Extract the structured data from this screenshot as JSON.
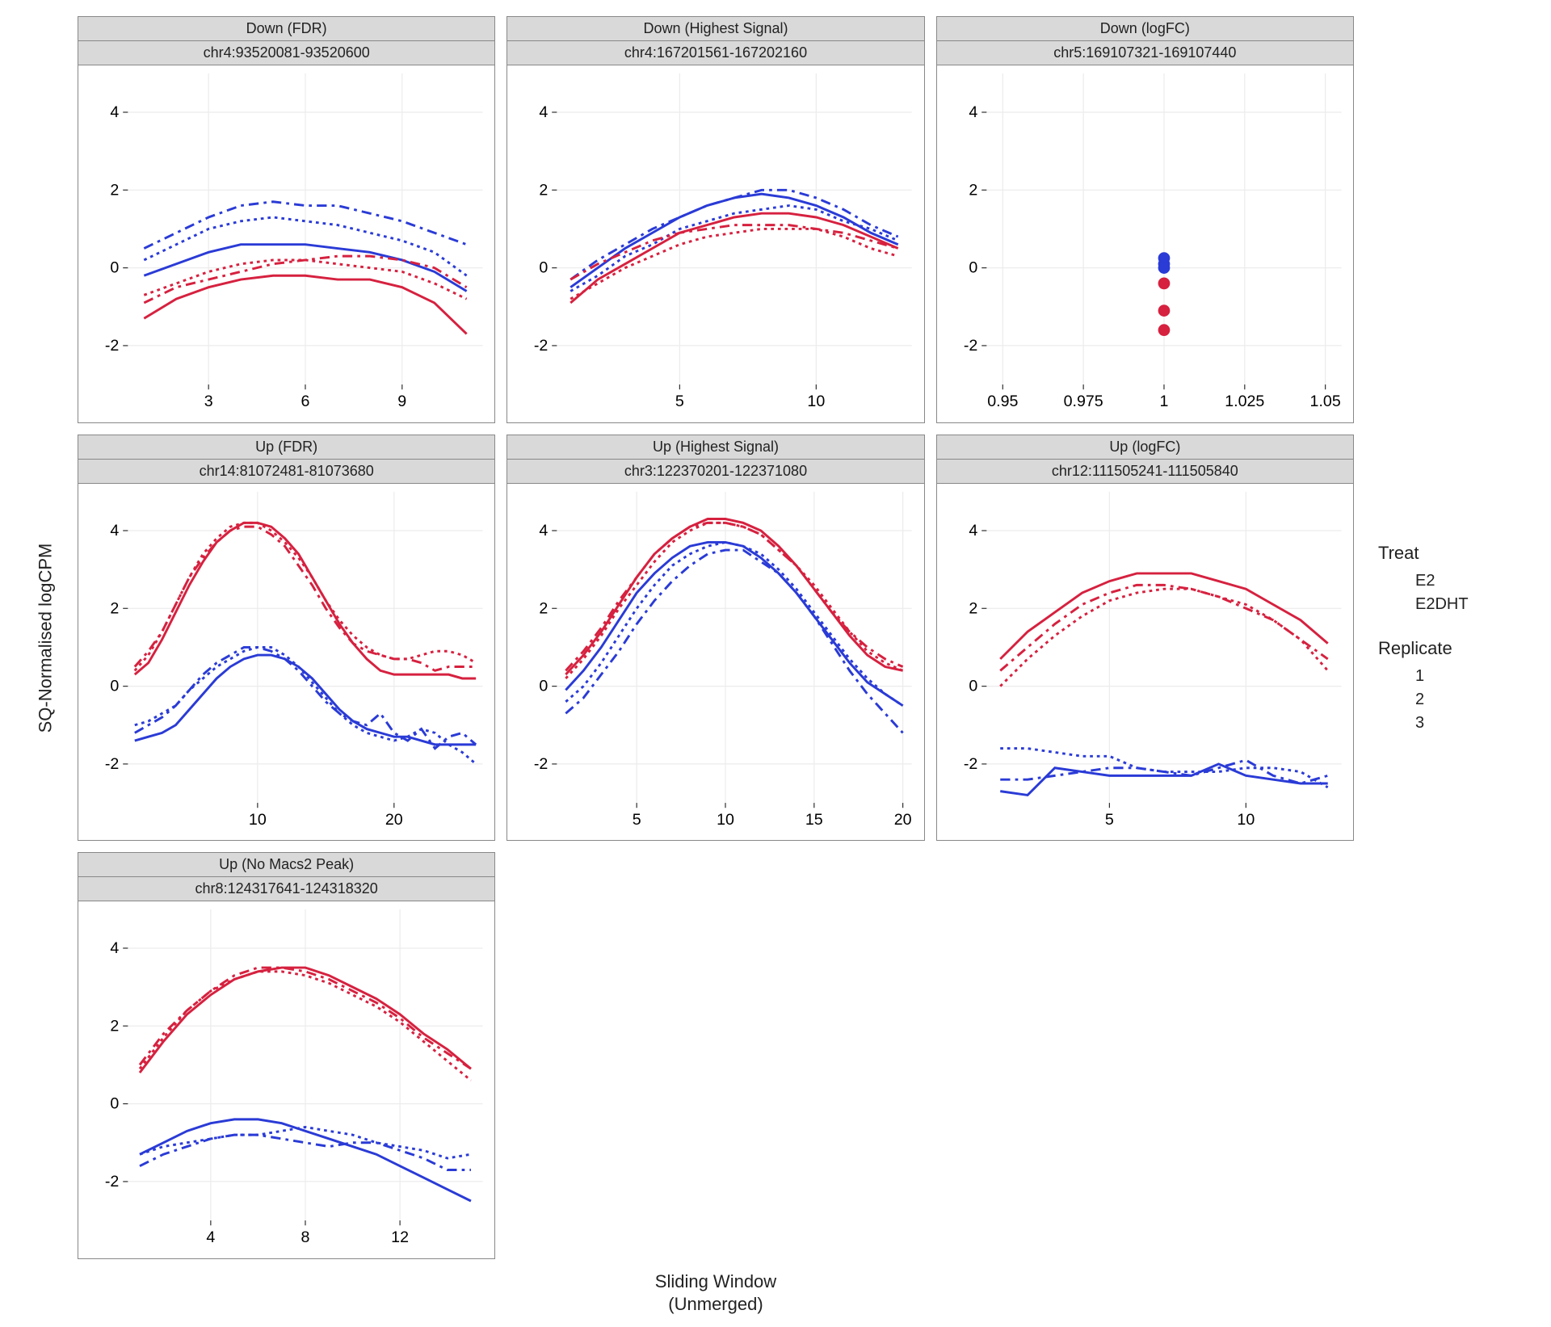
{
  "ylab": "SQ-Normalised logCPM",
  "xlab": "Sliding Window\n(Unmerged)",
  "legend": {
    "treat_title": "Treat",
    "treat": [
      {
        "name": "E2",
        "color": "#2a3bd6"
      },
      {
        "name": "E2DHT",
        "color": "#d6213f"
      }
    ],
    "rep_title": "Replicate",
    "rep": [
      {
        "name": "1",
        "dash": "solid"
      },
      {
        "name": "2",
        "dash": "dash2"
      },
      {
        "name": "3",
        "dash": "dash3"
      }
    ]
  },
  "chart_data": [
    {
      "title": "Down (FDR)",
      "subtitle": "chr4:93520081-93520600",
      "type": "line",
      "ylim": [
        -3,
        5
      ],
      "yticks": [
        -2,
        0,
        2,
        4
      ],
      "x": [
        1,
        2,
        3,
        4,
        5,
        6,
        7,
        8,
        9,
        10,
        11
      ],
      "xticks": [
        3,
        6,
        9
      ],
      "series": [
        {
          "treat": "E2",
          "rep": 1,
          "y": [
            -0.2,
            0.1,
            0.4,
            0.6,
            0.6,
            0.6,
            0.5,
            0.4,
            0.2,
            -0.1,
            -0.6
          ]
        },
        {
          "treat": "E2",
          "rep": 2,
          "y": [
            0.2,
            0.6,
            1.0,
            1.2,
            1.3,
            1.2,
            1.1,
            0.9,
            0.7,
            0.4,
            -0.2
          ]
        },
        {
          "treat": "E2",
          "rep": 3,
          "y": [
            0.5,
            0.9,
            1.3,
            1.6,
            1.7,
            1.6,
            1.6,
            1.4,
            1.2,
            0.9,
            0.6
          ]
        },
        {
          "treat": "E2DHT",
          "rep": 1,
          "y": [
            -1.3,
            -0.8,
            -0.5,
            -0.3,
            -0.2,
            -0.2,
            -0.3,
            -0.3,
            -0.5,
            -0.9,
            -1.7
          ]
        },
        {
          "treat": "E2DHT",
          "rep": 2,
          "y": [
            -0.7,
            -0.4,
            -0.1,
            0.1,
            0.2,
            0.2,
            0.1,
            0.0,
            -0.1,
            -0.4,
            -0.8
          ]
        },
        {
          "treat": "E2DHT",
          "rep": 3,
          "y": [
            -0.9,
            -0.5,
            -0.3,
            -0.1,
            0.1,
            0.2,
            0.3,
            0.3,
            0.2,
            0.0,
            -0.5
          ]
        }
      ]
    },
    {
      "title": "Down (Highest Signal)",
      "subtitle": "chr4:167201561-167202160",
      "type": "line",
      "ylim": [
        -3,
        5
      ],
      "yticks": [
        -2,
        0,
        2,
        4
      ],
      "x": [
        1,
        2,
        3,
        4,
        5,
        6,
        7,
        8,
        9,
        10,
        11,
        12,
        13
      ],
      "xticks": [
        5,
        10
      ],
      "series": [
        {
          "treat": "E2",
          "rep": 1,
          "y": [
            -0.5,
            0.0,
            0.5,
            0.9,
            1.3,
            1.6,
            1.8,
            1.9,
            1.8,
            1.6,
            1.3,
            0.9,
            0.6
          ]
        },
        {
          "treat": "E2",
          "rep": 2,
          "y": [
            -0.6,
            -0.2,
            0.3,
            0.6,
            1.0,
            1.2,
            1.4,
            1.5,
            1.6,
            1.5,
            1.2,
            1.0,
            0.7
          ]
        },
        {
          "treat": "E2",
          "rep": 3,
          "y": [
            -0.3,
            0.2,
            0.6,
            1.0,
            1.3,
            1.6,
            1.8,
            2.0,
            2.0,
            1.8,
            1.5,
            1.1,
            0.8
          ]
        },
        {
          "treat": "E2DHT",
          "rep": 1,
          "y": [
            -0.9,
            -0.3,
            0.1,
            0.5,
            0.9,
            1.1,
            1.3,
            1.4,
            1.4,
            1.3,
            1.1,
            0.8,
            0.5
          ]
        },
        {
          "treat": "E2DHT",
          "rep": 2,
          "y": [
            -0.8,
            -0.4,
            0.0,
            0.3,
            0.6,
            0.8,
            0.9,
            1.0,
            1.0,
            1.0,
            0.8,
            0.5,
            0.3
          ]
        },
        {
          "treat": "E2DHT",
          "rep": 3,
          "y": [
            -0.3,
            0.1,
            0.4,
            0.7,
            0.9,
            1.0,
            1.1,
            1.1,
            1.1,
            1.0,
            0.9,
            0.7,
            0.5
          ]
        }
      ]
    },
    {
      "title": "Down (logFC)",
      "subtitle": "chr5:169107321-169107440",
      "type": "scatter",
      "ylim": [
        -3,
        5
      ],
      "yticks": [
        -2,
        0,
        2,
        4
      ],
      "x": [
        1.0
      ],
      "xticks": [
        0.95,
        0.975,
        1.0,
        1.025,
        1.05
      ],
      "xlim": [
        0.945,
        1.055
      ],
      "points": [
        {
          "treat": "E2",
          "rep": 1,
          "x": 1.0,
          "y": 0.25
        },
        {
          "treat": "E2",
          "rep": 2,
          "x": 1.0,
          "y": 0.1
        },
        {
          "treat": "E2",
          "rep": 3,
          "x": 1.0,
          "y": 0.0
        },
        {
          "treat": "E2DHT",
          "rep": 1,
          "x": 1.0,
          "y": -0.4
        },
        {
          "treat": "E2DHT",
          "rep": 2,
          "x": 1.0,
          "y": -1.1
        },
        {
          "treat": "E2DHT",
          "rep": 3,
          "x": 1.0,
          "y": -1.6
        }
      ]
    },
    {
      "title": "Up (FDR)",
      "subtitle": "chr14:81072481-81073680",
      "type": "line",
      "ylim": [
        -3,
        5
      ],
      "yticks": [
        -2,
        0,
        2,
        4
      ],
      "x": [
        1,
        2,
        3,
        4,
        5,
        6,
        7,
        8,
        9,
        10,
        11,
        12,
        13,
        14,
        15,
        16,
        17,
        18,
        19,
        20,
        21,
        22,
        23,
        24,
        25,
        26
      ],
      "xticks": [
        10,
        20
      ],
      "series": [
        {
          "treat": "E2",
          "rep": 1,
          "y": [
            -1.4,
            -1.3,
            -1.2,
            -1.0,
            -0.6,
            -0.2,
            0.2,
            0.5,
            0.7,
            0.8,
            0.8,
            0.7,
            0.5,
            0.2,
            -0.2,
            -0.6,
            -0.9,
            -1.1,
            -1.2,
            -1.3,
            -1.3,
            -1.4,
            -1.5,
            -1.5,
            -1.5,
            -1.5
          ]
        },
        {
          "treat": "E2",
          "rep": 2,
          "y": [
            -1.0,
            -0.9,
            -0.7,
            -0.5,
            -0.1,
            0.2,
            0.5,
            0.7,
            0.9,
            1.0,
            1.0,
            0.8,
            0.5,
            0.1,
            -0.3,
            -0.7,
            -1.0,
            -1.2,
            -1.3,
            -1.4,
            -1.3,
            -1.1,
            -1.2,
            -1.5,
            -1.7,
            -2.0
          ]
        },
        {
          "treat": "E2",
          "rep": 3,
          "y": [
            -1.2,
            -1.0,
            -0.8,
            -0.5,
            -0.1,
            0.3,
            0.6,
            0.8,
            1.0,
            1.0,
            0.9,
            0.7,
            0.4,
            0.0,
            -0.4,
            -0.7,
            -0.9,
            -1.0,
            -0.7,
            -1.2,
            -1.4,
            -1.1,
            -1.6,
            -1.3,
            -1.2,
            -1.5
          ]
        },
        {
          "treat": "E2DHT",
          "rep": 1,
          "y": [
            0.3,
            0.6,
            1.2,
            1.9,
            2.6,
            3.2,
            3.7,
            4.0,
            4.2,
            4.2,
            4.1,
            3.8,
            3.4,
            2.8,
            2.2,
            1.6,
            1.1,
            0.7,
            0.4,
            0.3,
            0.3,
            0.3,
            0.3,
            0.3,
            0.2,
            0.2
          ]
        },
        {
          "treat": "E2DHT",
          "rep": 2,
          "y": [
            0.4,
            0.8,
            1.4,
            2.1,
            2.8,
            3.4,
            3.8,
            4.1,
            4.2,
            4.2,
            4.0,
            3.7,
            3.3,
            2.8,
            2.2,
            1.7,
            1.3,
            1.0,
            0.8,
            0.7,
            0.7,
            0.8,
            0.9,
            0.9,
            0.8,
            0.6
          ]
        },
        {
          "treat": "E2DHT",
          "rep": 3,
          "y": [
            0.5,
            0.9,
            1.4,
            2.1,
            2.8,
            3.3,
            3.7,
            4.0,
            4.1,
            4.1,
            3.9,
            3.6,
            3.1,
            2.6,
            2.0,
            1.5,
            1.1,
            0.9,
            0.8,
            0.7,
            0.7,
            0.6,
            0.4,
            0.5,
            0.5,
            0.5
          ]
        }
      ]
    },
    {
      "title": "Up (Highest Signal)",
      "subtitle": "chr3:122370201-122371080",
      "type": "line",
      "ylim": [
        -3,
        5
      ],
      "yticks": [
        -2,
        0,
        2,
        4
      ],
      "x": [
        1,
        2,
        3,
        4,
        5,
        6,
        7,
        8,
        9,
        10,
        11,
        12,
        13,
        14,
        15,
        16,
        17,
        18,
        19,
        20
      ],
      "xticks": [
        5,
        10,
        15,
        20
      ],
      "series": [
        {
          "treat": "E2",
          "rep": 1,
          "y": [
            -0.1,
            0.4,
            1.0,
            1.7,
            2.4,
            2.9,
            3.3,
            3.6,
            3.7,
            3.7,
            3.6,
            3.3,
            2.9,
            2.4,
            1.8,
            1.2,
            0.6,
            0.1,
            -0.2,
            -0.5
          ]
        },
        {
          "treat": "E2",
          "rep": 2,
          "y": [
            -0.4,
            0.0,
            0.6,
            1.3,
            2.0,
            2.6,
            3.1,
            3.4,
            3.6,
            3.7,
            3.6,
            3.4,
            3.0,
            2.5,
            1.9,
            1.3,
            0.7,
            0.2,
            -0.2,
            -0.5
          ]
        },
        {
          "treat": "E2",
          "rep": 3,
          "y": [
            -0.7,
            -0.3,
            0.3,
            0.9,
            1.6,
            2.2,
            2.7,
            3.1,
            3.4,
            3.5,
            3.5,
            3.2,
            2.9,
            2.4,
            1.8,
            1.1,
            0.4,
            -0.2,
            -0.7,
            -1.2
          ]
        },
        {
          "treat": "E2DHT",
          "rep": 1,
          "y": [
            0.3,
            0.8,
            1.4,
            2.1,
            2.8,
            3.4,
            3.8,
            4.1,
            4.3,
            4.3,
            4.2,
            4.0,
            3.6,
            3.1,
            2.5,
            1.9,
            1.3,
            0.8,
            0.5,
            0.4
          ]
        },
        {
          "treat": "E2DHT",
          "rep": 2,
          "y": [
            0.2,
            0.7,
            1.3,
            2.0,
            2.6,
            3.2,
            3.7,
            4.0,
            4.2,
            4.2,
            4.1,
            3.9,
            3.5,
            3.1,
            2.6,
            2.0,
            1.4,
            0.9,
            0.6,
            0.4
          ]
        },
        {
          "treat": "E2DHT",
          "rep": 3,
          "y": [
            0.4,
            0.9,
            1.5,
            2.2,
            2.8,
            3.4,
            3.8,
            4.1,
            4.2,
            4.2,
            4.1,
            3.9,
            3.5,
            3.1,
            2.5,
            1.9,
            1.4,
            1.0,
            0.7,
            0.5
          ]
        }
      ]
    },
    {
      "title": "Up (logFC)",
      "subtitle": "chr12:111505241-111505840",
      "type": "line",
      "ylim": [
        -3,
        5
      ],
      "yticks": [
        -2,
        0,
        2,
        4
      ],
      "x": [
        1,
        2,
        3,
        4,
        5,
        6,
        7,
        8,
        9,
        10,
        11,
        12,
        13
      ],
      "xticks": [
        5,
        10
      ],
      "series": [
        {
          "treat": "E2",
          "rep": 1,
          "y": [
            -2.7,
            -2.8,
            -2.1,
            -2.2,
            -2.3,
            -2.3,
            -2.3,
            -2.3,
            -2.0,
            -2.3,
            -2.4,
            -2.5,
            -2.5
          ]
        },
        {
          "treat": "E2",
          "rep": 2,
          "y": [
            -1.6,
            -1.6,
            -1.7,
            -1.8,
            -1.8,
            -2.1,
            -2.2,
            -2.2,
            -2.2,
            -2.1,
            -2.1,
            -2.2,
            -2.6
          ]
        },
        {
          "treat": "E2",
          "rep": 3,
          "y": [
            -2.4,
            -2.4,
            -2.3,
            -2.2,
            -2.1,
            -2.1,
            -2.2,
            -2.3,
            -2.1,
            -1.9,
            -2.3,
            -2.5,
            -2.3
          ]
        },
        {
          "treat": "E2DHT",
          "rep": 1,
          "y": [
            0.7,
            1.4,
            1.9,
            2.4,
            2.7,
            2.9,
            2.9,
            2.9,
            2.7,
            2.5,
            2.1,
            1.7,
            1.1
          ]
        },
        {
          "treat": "E2DHT",
          "rep": 2,
          "y": [
            0.0,
            0.7,
            1.3,
            1.8,
            2.2,
            2.4,
            2.5,
            2.5,
            2.3,
            2.1,
            1.7,
            1.2,
            0.4
          ]
        },
        {
          "treat": "E2DHT",
          "rep": 3,
          "y": [
            0.4,
            1.0,
            1.6,
            2.1,
            2.4,
            2.6,
            2.6,
            2.5,
            2.3,
            2.0,
            1.7,
            1.2,
            0.7
          ]
        }
      ]
    },
    {
      "title": "Up (No Macs2 Peak)",
      "subtitle": "chr8:124317641-124318320",
      "type": "line",
      "ylim": [
        -3,
        5
      ],
      "yticks": [
        -2,
        0,
        2,
        4
      ],
      "x": [
        1,
        2,
        3,
        4,
        5,
        6,
        7,
        8,
        9,
        10,
        11,
        12,
        13,
        14,
        15
      ],
      "xticks": [
        4,
        8,
        12
      ],
      "series": [
        {
          "treat": "E2",
          "rep": 1,
          "y": [
            -1.3,
            -1.0,
            -0.7,
            -0.5,
            -0.4,
            -0.4,
            -0.5,
            -0.7,
            -0.9,
            -1.1,
            -1.3,
            -1.6,
            -1.9,
            -2.2,
            -2.5
          ]
        },
        {
          "treat": "E2",
          "rep": 2,
          "y": [
            -1.3,
            -1.1,
            -1.0,
            -0.9,
            -0.8,
            -0.8,
            -0.7,
            -0.6,
            -0.7,
            -0.8,
            -1.0,
            -1.1,
            -1.2,
            -1.4,
            -1.3
          ]
        },
        {
          "treat": "E2",
          "rep": 3,
          "y": [
            -1.6,
            -1.3,
            -1.1,
            -0.9,
            -0.8,
            -0.8,
            -0.9,
            -1.0,
            -1.1,
            -1.0,
            -1.0,
            -1.2,
            -1.4,
            -1.7,
            -1.7
          ]
        },
        {
          "treat": "E2DHT",
          "rep": 1,
          "y": [
            0.8,
            1.6,
            2.3,
            2.8,
            3.2,
            3.4,
            3.5,
            3.5,
            3.3,
            3.0,
            2.7,
            2.3,
            1.8,
            1.4,
            0.9
          ]
        },
        {
          "treat": "E2DHT",
          "rep": 2,
          "y": [
            0.9,
            1.7,
            2.4,
            2.9,
            3.2,
            3.4,
            3.4,
            3.3,
            3.1,
            2.8,
            2.5,
            2.1,
            1.6,
            1.1,
            0.6
          ]
        },
        {
          "treat": "E2DHT",
          "rep": 3,
          "y": [
            1.0,
            1.8,
            2.4,
            2.9,
            3.3,
            3.5,
            3.5,
            3.4,
            3.2,
            2.9,
            2.6,
            2.2,
            1.7,
            1.3,
            0.9
          ]
        }
      ]
    }
  ]
}
